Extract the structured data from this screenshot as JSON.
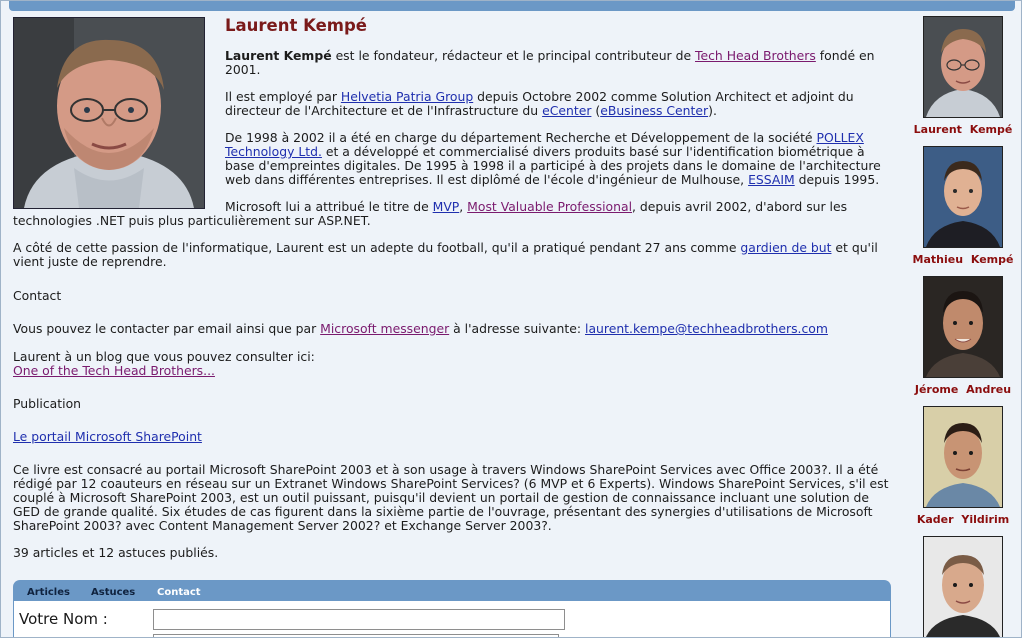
{
  "person": {
    "name": "Laurent Kempé",
    "intro_bold": "Laurent Kempé",
    "intro_text": " est le fondateur, rédacteur et le principal contributeur de ",
    "intro_link": "Tech Head Brothers",
    "intro_end": " fondé en 2001.",
    "p2_a": "Il est employé par ",
    "p2_link1": "Helvetia Patria Group",
    "p2_b": " depuis Octobre 2002 comme Solution Architect et adjoint du directeur de l'Architecture et de l'Infrastructure du ",
    "p2_link2": "eCenter",
    "p2_c": " (",
    "p2_link3": "eBusiness Center",
    "p2_d": ").",
    "p3_a": "De 1998 à 2002 il a été en charge du département Recherche et Développement de la société ",
    "p3_link1": "POLLEX Technology Ltd.",
    "p3_b": " et a développé et commercialisé divers produits basé sur l'identification biométrique à base d'empreintes digitales. De 1995 à 1998 il a participé à des projets dans le domaine de l'architecture web dans différentes entreprises. Il est diplômé de l'école d'ingénieur de Mulhouse, ",
    "p3_link2": "ESSAIM",
    "p3_c": " depuis 1995.",
    "p4_a": "Microsoft lui a attribué le titre de ",
    "p4_link1": "MVP",
    "p4_b": ", ",
    "p4_link2": "Most Valuable Professional",
    "p4_c": ", depuis avril 2002, d'abord sur les technologies .NET puis plus particulièrement sur ASP.NET.",
    "p5_a": "A côté de cette passion de l'informatique, Laurent est un adepte du football, qu'il a pratiqué pendant 27 ans comme ",
    "p5_link": "gardien de but",
    "p5_b": " et qu'il vient juste de reprendre."
  },
  "contact": {
    "heading": "Contact",
    "text_a": "Vous pouvez le contacter par email ainsi que par ",
    "messenger_link": "Microsoft messenger",
    "text_b": " à l'adresse suivante: ",
    "email_link": "laurent.kempe@techheadbrothers.com",
    "blog_text": "Laurent à un blog que vous pouvez consulter ici:",
    "blog_link": "One of the Tech Head Brothers..."
  },
  "publication": {
    "heading": "Publication",
    "book_link": "Le portail Microsoft SharePoint",
    "description": "Ce livre est consacré au portail Microsoft SharePoint 2003 et à son usage à travers Windows SharePoint Services avec Office 2003?. Il a été rédigé par 12 coauteurs en réseau sur un Extranet Windows SharePoint Services? (6 MVP et 6 Experts). Windows SharePoint Services, s'il est couplé à Microsoft SharePoint 2003, est un outil puissant, puisqu'il devient un portail de gestion de connaissance incluant une solution de GED de grande qualité. Six études de cas figurent dans la sixième partie de l'ouvrage, présentant des synergies d'utilisations de Microsoft SharePoint 2003? avec Content Management Server 2002? et Exchange Server 2003?."
  },
  "stats": "39 articles et 12 astuces publiés.",
  "tabs": {
    "articles": "Articles",
    "astuces": "Astuces",
    "contact": "Contact"
  },
  "form": {
    "name_label": "Votre Nom :",
    "name_value": ""
  },
  "members": [
    {
      "name": "Laurent Kempé"
    },
    {
      "name": "Mathieu Kempé"
    },
    {
      "name": "Jérome Andreu"
    },
    {
      "name": "Kader Yildirim"
    }
  ],
  "colors": {
    "tab_bar": "#6b98c6",
    "background": "#eef3f9",
    "heading": "#7a1a1a",
    "link": "#1f2fae",
    "visited_link": "#7a1a6e"
  },
  "icons": [
    "portrait-photo",
    "member-photo"
  ]
}
